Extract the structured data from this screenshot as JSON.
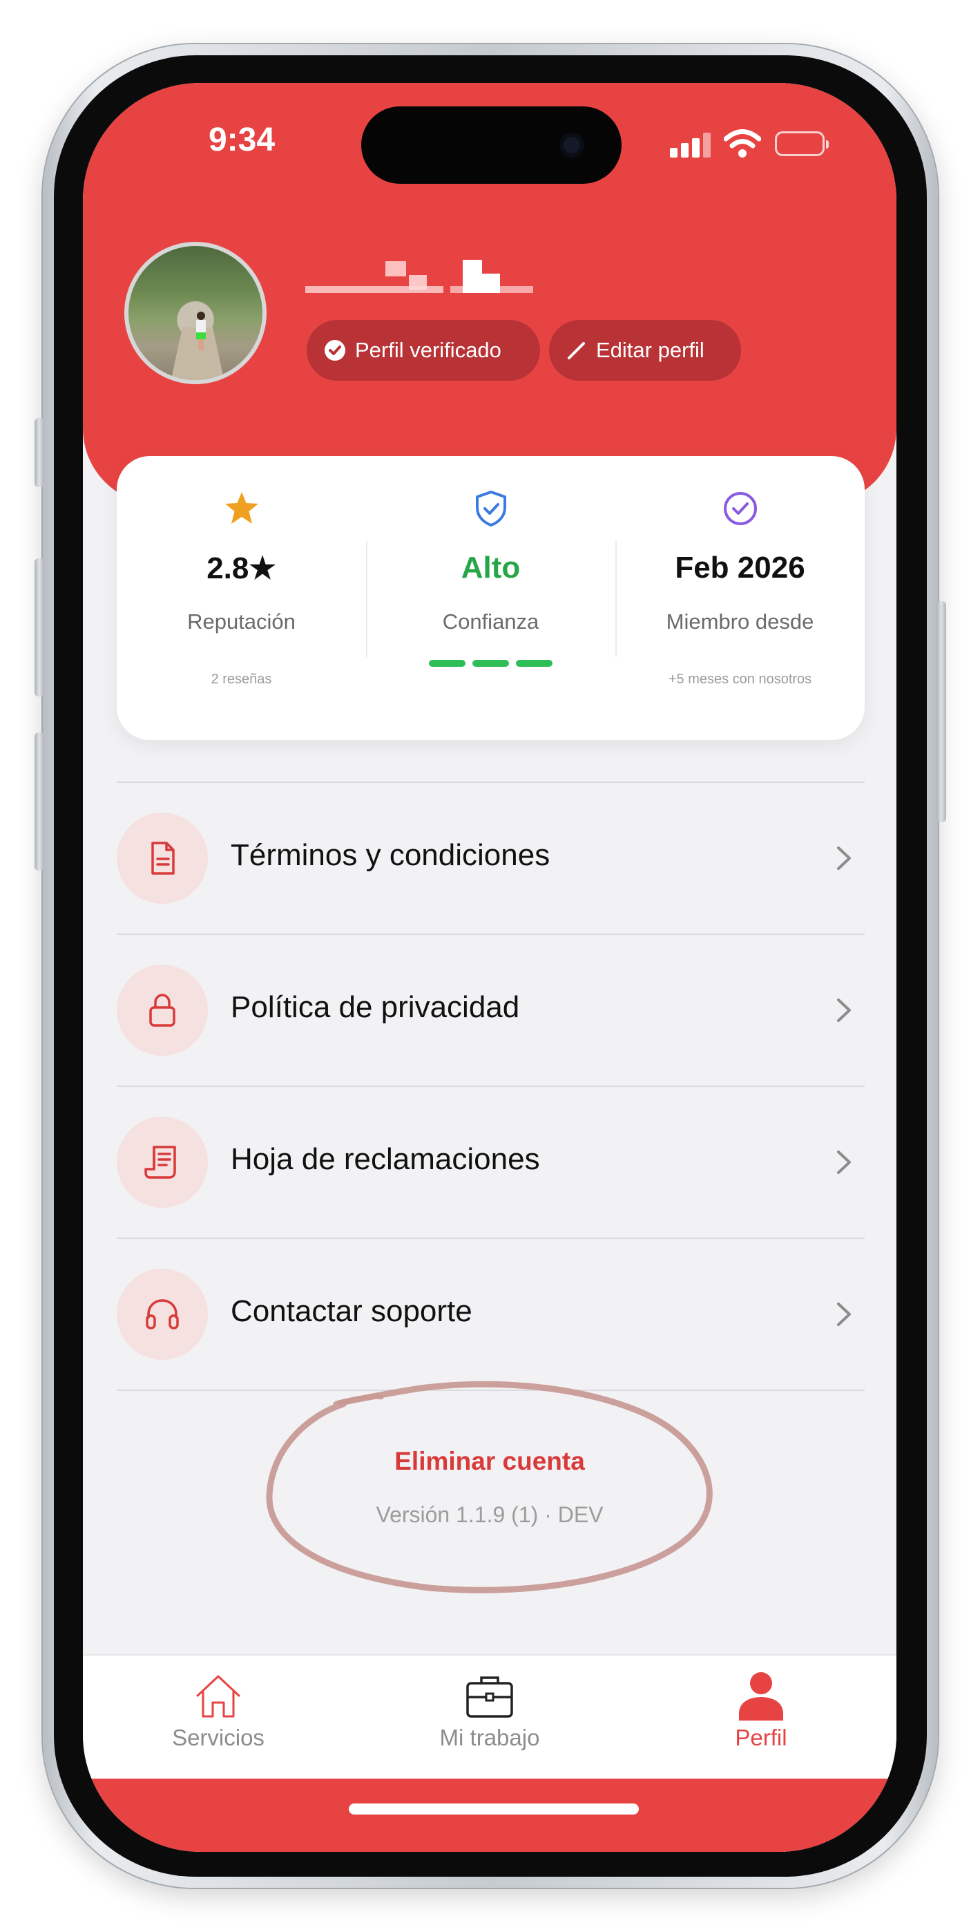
{
  "status_bar": {
    "time": "9:34"
  },
  "profile": {
    "name": "[redacted]",
    "verified_label": "Perfil verificado",
    "edit_label": "Editar perfil"
  },
  "stats": {
    "reputation": {
      "value": "2.8★",
      "label": "Reputación",
      "sub": "2 reseñas"
    },
    "trust": {
      "value": "Alto",
      "label": "Confianza",
      "level_segments": 3
    },
    "member": {
      "value": "Feb 2026",
      "label": "Miembro desde",
      "sub": "+5 meses con nosotros"
    }
  },
  "menu": [
    {
      "label": "Términos y condiciones",
      "icon": "document-icon"
    },
    {
      "label": "Política de privacidad",
      "icon": "lock-icon"
    },
    {
      "label": "Hoja de reclamaciones",
      "icon": "receipt-icon"
    },
    {
      "label": "Contactar soporte",
      "icon": "headphones-icon"
    }
  ],
  "delete_account_label": "Eliminar cuenta",
  "version_text": "Versión 1.1.9 (1) · DEV",
  "tabs": [
    {
      "label": "Servicios",
      "icon": "home-icon",
      "active": false
    },
    {
      "label": "Mi trabajo",
      "icon": "briefcase-icon",
      "active": false
    },
    {
      "label": "Perfil",
      "icon": "person-icon",
      "active": true
    }
  ],
  "colors": {
    "brand_red": "#e84343",
    "pill_bg": "#b83236",
    "trust_green": "#2ebd57",
    "star_orange": "#f0a020",
    "shield_blue": "#3a7be0",
    "check_purple": "#8a5be0"
  }
}
